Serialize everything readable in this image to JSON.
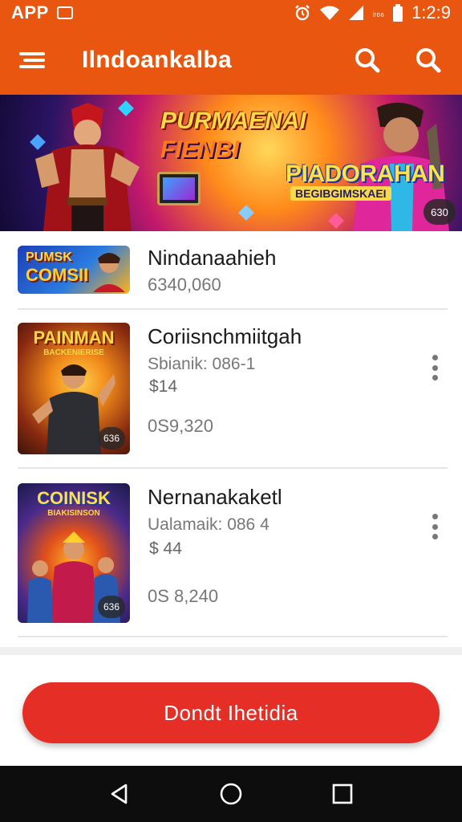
{
  "status_bar": {
    "app_label": "APP",
    "network_text": "ᵢᵣ₀₆",
    "time": "1:2:9",
    "icons": [
      "screen-icon",
      "alarm-icon",
      "wifi-icon",
      "signal-icon",
      "battery-icon"
    ]
  },
  "app_bar": {
    "title": "Ilndoankalba",
    "icons": [
      "menu-icon",
      "search-icon",
      "search-icon"
    ],
    "accent": "#e8560f"
  },
  "banner": {
    "title_line1": "PURMAENAI",
    "title_line2": "FIENBI",
    "brand": "PIADORAHAN",
    "tagline": "BEGIBGIMSKAEI",
    "badge": "630"
  },
  "items": [
    {
      "name": "Nindanaahieh",
      "count": "6340,060",
      "thumb_title": "PUMSK",
      "thumb_sub": "COMSII"
    },
    {
      "name": "Coriisnchmiitgah",
      "meta": "Sbianik: 086-1",
      "price": "$14",
      "count": "0S9,320",
      "thumb_title": "PAINMAN",
      "thumb_sub": "BACKENIERISE",
      "badge": "636"
    },
    {
      "name": "Nernanakaketl",
      "meta": "Ualamaik: 086 4",
      "price": "$ 44",
      "count": "0S 8,240",
      "thumb_title": "COINISK",
      "thumb_sub": "BIAKISINSON",
      "badge": "636"
    }
  ],
  "cta": {
    "label": "Dondt Ihetidia",
    "color": "#e52e26"
  },
  "nav_bar": {
    "icons": [
      "back-icon",
      "home-icon",
      "recents-icon"
    ]
  }
}
